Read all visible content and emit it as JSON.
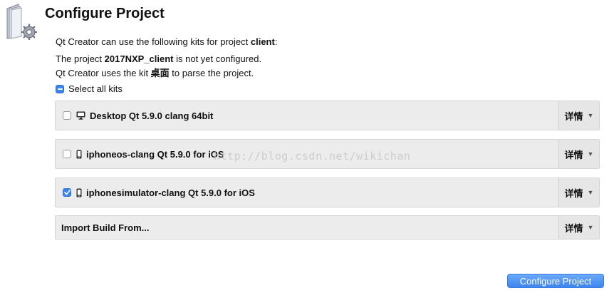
{
  "header": {
    "title": "Configure Project",
    "logo_icon": "folder-gear-icon"
  },
  "intro": {
    "kits_prefix": "Qt Creator can use the following kits for project ",
    "project_name": "client",
    "kits_suffix": ":",
    "not_configured_prefix": "The project ",
    "project_full_name": "2017NXP_client",
    "not_configured_suffix": " is not yet configured.",
    "parse_prefix": "Qt Creator uses the kit ",
    "parse_kit": "桌面",
    "parse_suffix": " to parse the project."
  },
  "select_all": {
    "label": "Select all kits",
    "state": "partial"
  },
  "kits": [
    {
      "label": "Desktop Qt 5.9.0 clang 64bit",
      "checked": false,
      "icon": "desktop-monitor-icon",
      "details_label": "详情"
    },
    {
      "label": "iphoneos-clang Qt 5.9.0 for iOS",
      "checked": false,
      "icon": "mobile-device-icon",
      "details_label": "详情"
    },
    {
      "label": "iphonesimulator-clang Qt 5.9.0 for iOS",
      "checked": true,
      "icon": "mobile-device-icon",
      "details_label": "详情"
    }
  ],
  "import_build": {
    "label": "Import Build From...",
    "details_label": "详情"
  },
  "watermark": "http://blog.csdn.net/wikichan",
  "footer": {
    "configure_button": "Configure Project"
  },
  "colors": {
    "accent": "#3a86e8",
    "panel_bg": "#ececec",
    "button_blue": "#4a8ff2"
  }
}
